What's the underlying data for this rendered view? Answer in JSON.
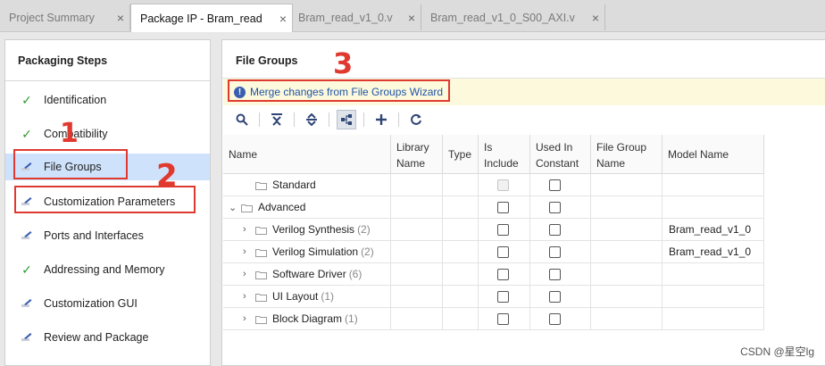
{
  "tabs": [
    {
      "label": "Project Summary",
      "active": false
    },
    {
      "label": "Package IP - Bram_read",
      "active": true
    },
    {
      "label": "Bram_read_v1_0.v",
      "active": false
    },
    {
      "label": "Bram_read_v1_0_S00_AXI.v",
      "active": false
    }
  ],
  "close_glyph": "×",
  "left": {
    "title": "Packaging Steps",
    "steps": [
      {
        "label": "Identification",
        "icon": "check-icon"
      },
      {
        "label": "Compatibility",
        "icon": "check-icon"
      },
      {
        "label": "File Groups",
        "icon": "edit-icon",
        "selected": true
      },
      {
        "label": "Customization Parameters",
        "icon": "edit-icon"
      },
      {
        "label": "Ports and Interfaces",
        "icon": "edit-icon"
      },
      {
        "label": "Addressing and Memory",
        "icon": "check-icon"
      },
      {
        "label": "Customization GUI",
        "icon": "edit-icon"
      },
      {
        "label": "Review and Package",
        "icon": "edit-icon"
      }
    ]
  },
  "right": {
    "title": "File Groups",
    "banner_link": "Merge changes from File Groups Wizard",
    "toolbar": [
      "search-icon",
      "collapse-all-icon",
      "expand-all-icon",
      "hierarchy-icon",
      "add-icon",
      "refresh-icon"
    ],
    "columns": [
      "Name",
      "Library Name",
      "Type",
      "Is Include",
      "Used In Constant",
      "File Group Name",
      "Model Name"
    ],
    "rows": [
      {
        "name": "Standard",
        "count": "",
        "expander": "",
        "indent": 1,
        "include_disabled": true,
        "model": ""
      },
      {
        "name": "Advanced",
        "count": "",
        "expander": "⌄",
        "indent": 0,
        "include_disabled": false,
        "model": ""
      },
      {
        "name": "Verilog Synthesis",
        "count": "(2)",
        "expander": "›",
        "indent": 1,
        "include_disabled": false,
        "model": "Bram_read_v1_0"
      },
      {
        "name": "Verilog Simulation",
        "count": "(2)",
        "expander": "›",
        "indent": 1,
        "include_disabled": false,
        "model": "Bram_read_v1_0"
      },
      {
        "name": "Software Driver",
        "count": "(6)",
        "expander": "›",
        "indent": 1,
        "include_disabled": false,
        "model": ""
      },
      {
        "name": "UI Layout",
        "count": "(1)",
        "expander": "›",
        "indent": 1,
        "include_disabled": false,
        "model": ""
      },
      {
        "name": "Block Diagram",
        "count": "(1)",
        "expander": "›",
        "indent": 1,
        "include_disabled": false,
        "model": ""
      }
    ]
  },
  "annotations": {
    "one": "1",
    "two": "2",
    "three": "3"
  },
  "watermark": "CSDN @星空lg",
  "colors": {
    "selected": "#cfe2fb",
    "annotation": "#e03a30",
    "banner": "#fdf9dc",
    "check": "#2e9a2e"
  }
}
